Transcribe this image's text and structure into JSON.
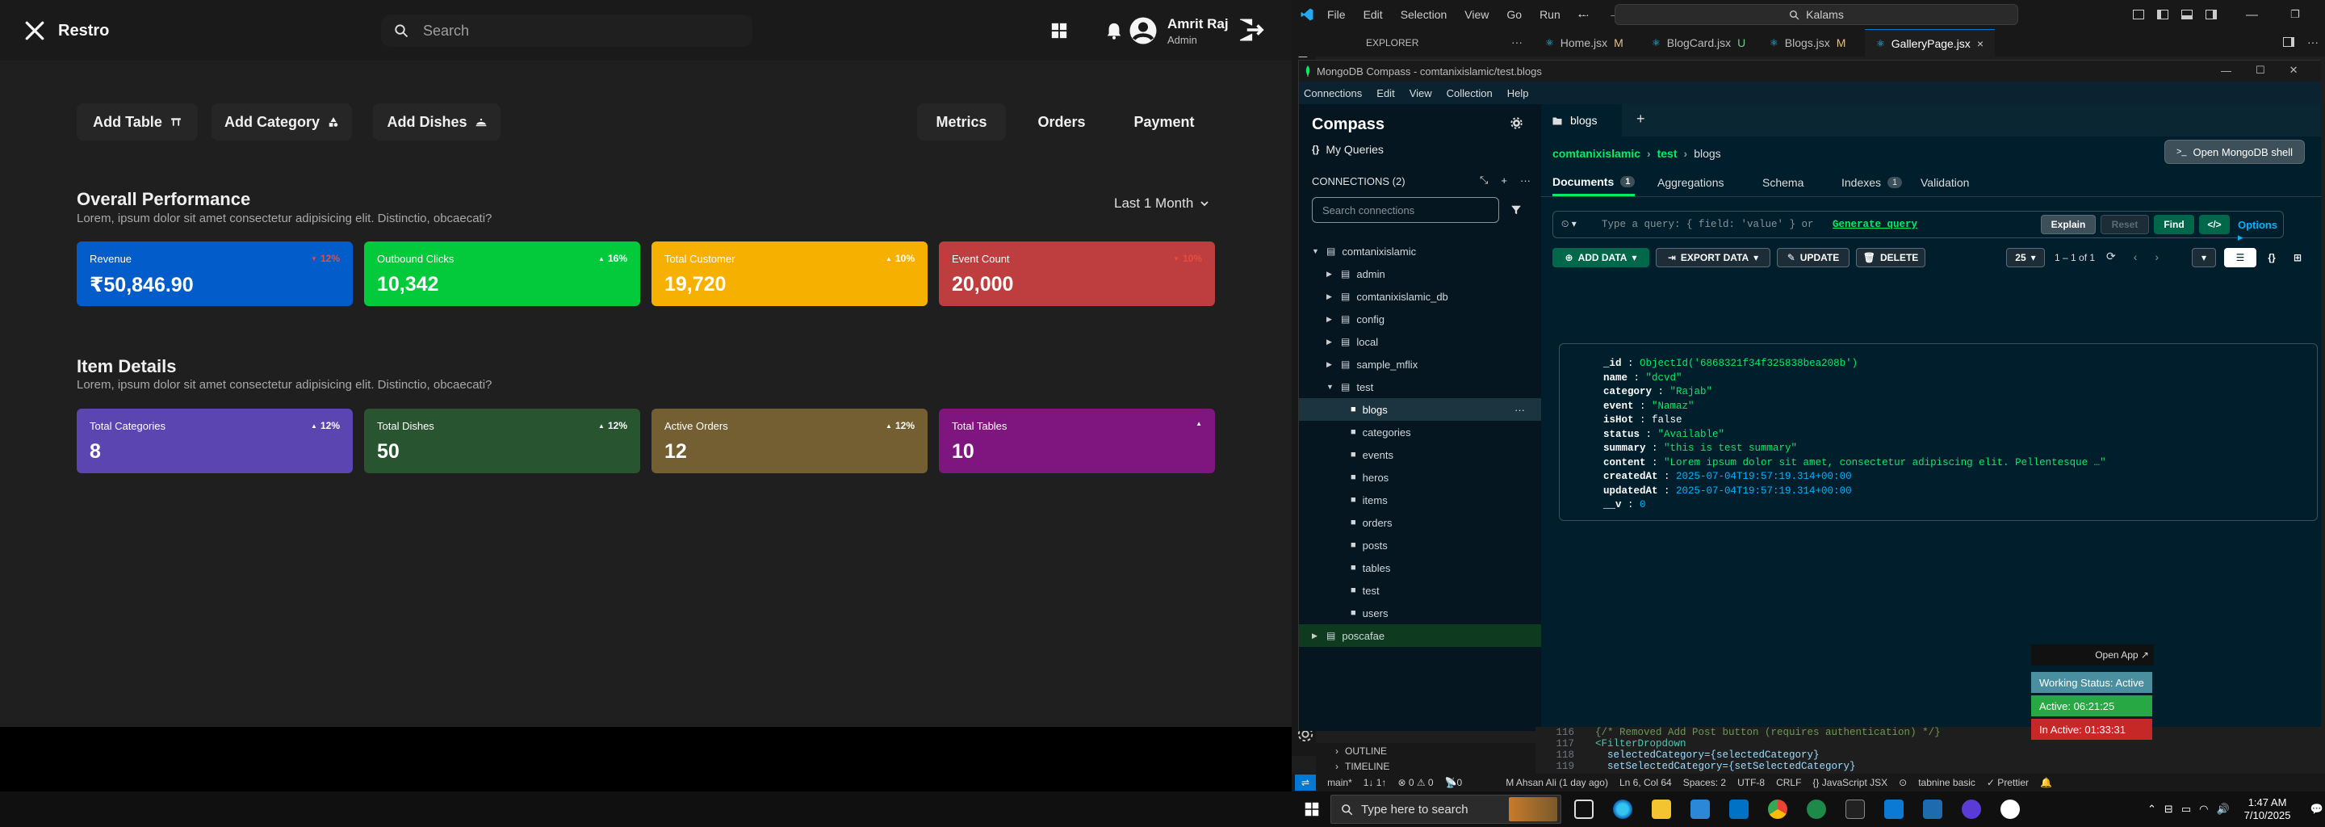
{
  "restro": {
    "brand": "Restro",
    "search_placeholder": "Search",
    "user": {
      "name": "Amrit Raj",
      "role": "Admin"
    },
    "actions": [
      "Add Table",
      "Add Category",
      "Add Dishes"
    ],
    "tabs": [
      "Metrics",
      "Orders",
      "Payment"
    ],
    "overall": {
      "title": "Overall Performance",
      "subtitle": "Lorem, ipsum dolor sit amet consectetur adipisicing elit. Distinctio, obcaecati?",
      "period": "Last 1 Month",
      "cards": [
        {
          "label": "Revenue",
          "value": "₹50,846.90",
          "pct": "12%",
          "color": "#025cca",
          "pct_color": "#e74c3c",
          "trend": "down"
        },
        {
          "label": "Outbound Clicks",
          "value": "10,342",
          "pct": "16%",
          "color": "#02ca3a",
          "pct_color": "#ffffff",
          "trend": "up"
        },
        {
          "label": "Total Customer",
          "value": "19,720",
          "pct": "10%",
          "color": "#f6b100",
          "pct_color": "#ffffff",
          "trend": "up"
        },
        {
          "label": "Event Count",
          "value": "20,000",
          "pct": "10%",
          "color": "#be3e3f",
          "pct_color": "#e74c3c",
          "trend": "down"
        }
      ]
    },
    "items": {
      "title": "Item Details",
      "subtitle": "Lorem, ipsum dolor sit amet consectetur adipisicing elit. Distinctio, obcaecati?",
      "cards": [
        {
          "label": "Total Categories",
          "value": "8",
          "pct": "12%",
          "color": "#5b45b0",
          "trend": "up"
        },
        {
          "label": "Total Dishes",
          "value": "50",
          "pct": "12%",
          "color": "#285430",
          "trend": "up"
        },
        {
          "label": "Active Orders",
          "value": "12",
          "pct": "12%",
          "color": "#735f32",
          "trend": "up"
        },
        {
          "label": "Total Tables",
          "value": "10",
          "pct": "",
          "color": "#7f167f",
          "trend": "up"
        }
      ]
    }
  },
  "vscode": {
    "menu": [
      "File",
      "Edit",
      "Selection",
      "View",
      "Go",
      "Run",
      "···"
    ],
    "command_center": "Kalams",
    "explorer_label": "EXPLORER",
    "tabs": [
      {
        "name": "Home.jsx",
        "badge": "M"
      },
      {
        "name": "BlogCard.jsx",
        "badge": "U"
      },
      {
        "name": "Blogs.jsx",
        "badge": "M"
      },
      {
        "name": "GalleryPage.jsx",
        "badge": "×"
      }
    ],
    "outline": "OUTLINE",
    "timeline": "TIMELINE",
    "code_lines": [
      {
        "num": "116",
        "text": "{/* Removed Add Post button (requires authentication) */}"
      },
      {
        "num": "117",
        "text": "<FilterDropdown"
      },
      {
        "num": "118",
        "text": "  selectedCategory={selectedCategory}"
      },
      {
        "num": "119",
        "text": "  setSelectedCategory={setSelectedCategory}"
      }
    ],
    "status": {
      "branch": "main*",
      "sync": "1↓ 1↑",
      "problems": "⊗ 0 ⚠ 0",
      "blame": "M Ahsan Ali (1 day ago)",
      "position": "Ln 6, Col 64",
      "spaces": "Spaces: 2",
      "encoding": "UTF-8",
      "eol": "CRLF",
      "language": "{} JavaScript JSX",
      "tabnine": "tabnine basic",
      "prettier": "✓ Prettier"
    }
  },
  "compass": {
    "window_title": "MongoDB Compass - comtanixislamic/test.blogs",
    "menu": [
      "Connections",
      "Edit",
      "View",
      "Collection",
      "Help"
    ],
    "brand": "Compass",
    "my_queries": "My Queries",
    "connections_label": "CONNECTIONS (2)",
    "search_placeholder": "Search connections",
    "tree": [
      {
        "name": "comtanixislamic",
        "level": 0,
        "type": "conn",
        "open": true
      },
      {
        "name": "admin",
        "level": 1,
        "type": "db"
      },
      {
        "name": "comtanixislamic_db",
        "level": 1,
        "type": "db"
      },
      {
        "name": "config",
        "level": 1,
        "type": "db"
      },
      {
        "name": "local",
        "level": 1,
        "type": "db"
      },
      {
        "name": "sample_mflix",
        "level": 1,
        "type": "db"
      },
      {
        "name": "test",
        "level": 1,
        "type": "db",
        "open": true
      },
      {
        "name": "blogs",
        "level": 2,
        "type": "coll",
        "selected": true
      },
      {
        "name": "categories",
        "level": 2,
        "type": "coll"
      },
      {
        "name": "events",
        "level": 2,
        "type": "coll"
      },
      {
        "name": "heros",
        "level": 2,
        "type": "coll"
      },
      {
        "name": "items",
        "level": 2,
        "type": "coll"
      },
      {
        "name": "orders",
        "level": 2,
        "type": "coll"
      },
      {
        "name": "posts",
        "level": 2,
        "type": "coll"
      },
      {
        "name": "tables",
        "level": 2,
        "type": "coll"
      },
      {
        "name": "test",
        "level": 2,
        "type": "coll"
      },
      {
        "name": "users",
        "level": 2,
        "type": "coll"
      },
      {
        "name": "poscafae",
        "level": 0,
        "type": "conn",
        "highlight": true
      }
    ],
    "tab_label": "blogs",
    "breadcrumb": {
      "conn": "comtanixislamic",
      "db": "test",
      "coll": "blogs"
    },
    "shell_button": "Open MongoDB shell",
    "subtabs": [
      {
        "label": "Documents",
        "count": "1",
        "active": true
      },
      {
        "label": "Aggregations",
        "count": ""
      },
      {
        "label": "Schema",
        "count": ""
      },
      {
        "label": "Indexes",
        "count": "1"
      },
      {
        "label": "Validation",
        "count": ""
      }
    ],
    "query_placeholder": "Type a query: { field: 'value' } or",
    "generate_query": "Generate query",
    "explain": "Explain",
    "reset": "Reset",
    "find": "Find",
    "options": "Options ▸",
    "add_data": "ADD DATA",
    "export_data": "EXPORT DATA",
    "update": "UPDATE",
    "delete": "DELETE",
    "page_size": "25",
    "range": "1 – 1 of 1",
    "document": [
      {
        "key": "_id",
        "value": "ObjectId('6868321f34f325838bea208b')",
        "kind": "s"
      },
      {
        "key": "name",
        "value": "\"dcvd\"",
        "kind": "s"
      },
      {
        "key": "category",
        "value": "\"Rajab\"",
        "kind": "s"
      },
      {
        "key": "event",
        "value": "\"Namaz\"",
        "kind": "s"
      },
      {
        "key": "isHot",
        "value": "false",
        "kind": "b"
      },
      {
        "key": "status",
        "value": "\"Available\"",
        "kind": "s"
      },
      {
        "key": "summary",
        "value": "\"this is test summary\"",
        "kind": "s"
      },
      {
        "key": "content",
        "value": "\"Lorem ipsum dolor sit amet, consectetur adipiscing elit. Pellentesque …\"",
        "kind": "s"
      },
      {
        "key": "createdAt",
        "value": "2025-07-04T19:57:19.314+00:00",
        "kind": "n"
      },
      {
        "key": "updatedAt",
        "value": "2025-07-04T19:57:19.314+00:00",
        "kind": "n"
      },
      {
        "key": "__v",
        "value": "0",
        "kind": "n"
      }
    ]
  },
  "widget": {
    "open_app": "Open App ↗",
    "working": "Working Status: Active",
    "active": "Active: 06:21:25",
    "inactive": "In Active: 01:33:31"
  },
  "taskbar": {
    "search_placeholder": "Type here to search",
    "time": "1:47 AM",
    "date": "7/10/2025"
  }
}
